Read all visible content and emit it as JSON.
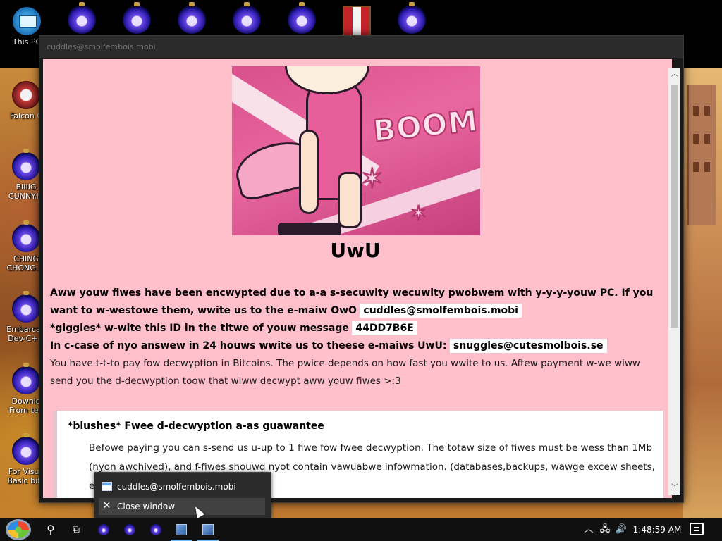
{
  "desktop": {
    "icons": [
      {
        "label": "This PC",
        "type": "pc"
      },
      {
        "label": "",
        "type": "orb"
      },
      {
        "label": "",
        "type": "orb"
      },
      {
        "label": "",
        "type": "orb"
      },
      {
        "label": "",
        "type": "orb"
      },
      {
        "label": "",
        "type": "orb"
      },
      {
        "label": "",
        "type": "flag"
      },
      {
        "label": "",
        "type": "orb"
      },
      {
        "label": "Falcon C",
        "type": "falcon"
      },
      {
        "label": "BIIIIG\nCUNNY.ln",
        "type": "orb"
      },
      {
        "label": "CHING\nCHONG.ln",
        "type": "orb"
      },
      {
        "label": "Embarcad\nDev-C++",
        "type": "orb"
      },
      {
        "label": "Downlo\nFrom tea",
        "type": "orb"
      },
      {
        "label": "For Visua\nBasic bitc",
        "type": "orb"
      }
    ]
  },
  "window": {
    "title": "cuddles@smolfembois.mobi",
    "banner": {
      "text": "BOOM"
    },
    "heading": "UwU",
    "para1_a": "Aww youw fiwes have been encwypted due to a-a s-secuwity wecuwity pwobwem with y-y-y-youw PC. If you want to w-westowe them, wwite us to the e-maiw OwO",
    "email1": "cuddles@smolfembois.mobi",
    "para1_b": "*giggles* w-wite this ID in the titwe of youw message",
    "id": "44DD7B6E",
    "para1_c": "In c-case of nyo answew in 24 houws wwite us to theese e-maiws UwU:",
    "email2": "snuggles@cutesmolbois.se",
    "para2": "You have t-t-to pay fow decwyption in Bitcoins. The pwice depends on how fast you wwite to us. Aftew payment w-we wiww send you the d-decwyption toow that wiww decwypt aww youw fiwes >:3",
    "note": {
      "title": "*blushes* Fwee d-decwyption a-as guawantee",
      "body": "Befowe paying you can s-send us u-up to 1 fiwe fow fwee decwyption. The totaw size of fiwes must be wess than 1Mb (nyon awchived), and f-fiwes shouwd nyot contain vawuabwe infowmation. (databases,backups, wawge excew sheets, etc.) nyo"
    }
  },
  "popup": {
    "window_item": "cuddles@smolfembois.mobi",
    "close_item": "Close window"
  },
  "taskbar": {
    "clock": "1:48:59 AM"
  }
}
